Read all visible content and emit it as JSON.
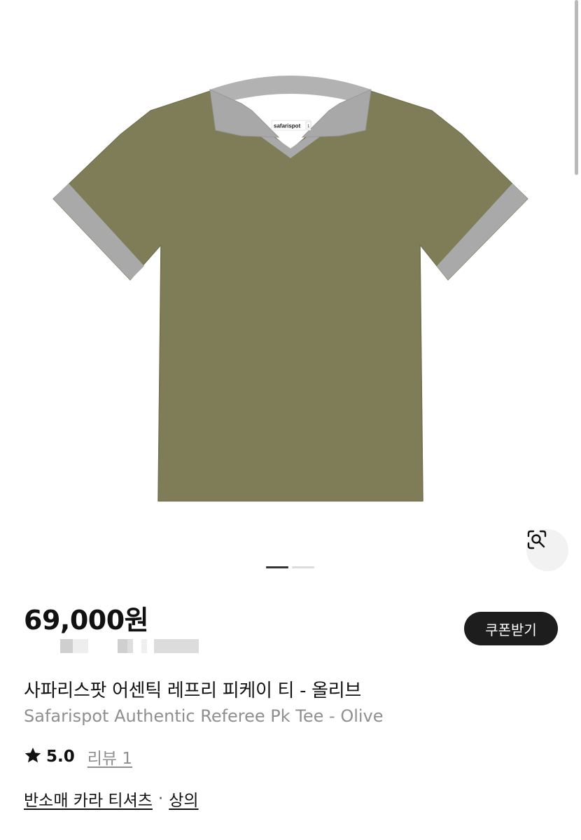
{
  "product_image": {
    "garment_color": "#7f7d58",
    "trim_color": "#a9a9a9",
    "label_text": "safarispot",
    "label_size": "1"
  },
  "carousel": {
    "total": 2,
    "active_index": 0
  },
  "icons": {
    "lens": "lens-search-icon",
    "rating": "star-icon"
  },
  "price": "69,000원",
  "coupon_button": "쿠폰받기",
  "product": {
    "name_ko": "사파리스팟 어센틱 레프리 피케이 티 - 올리브",
    "name_en": "Safarispot Authentic Referee Pk Tee - Olive"
  },
  "rating": {
    "value": "5.0",
    "reviews": "리뷰 1"
  },
  "categories": {
    "sub": "반소매 카라 티셔츠",
    "separator": "·",
    "main": "상의"
  }
}
